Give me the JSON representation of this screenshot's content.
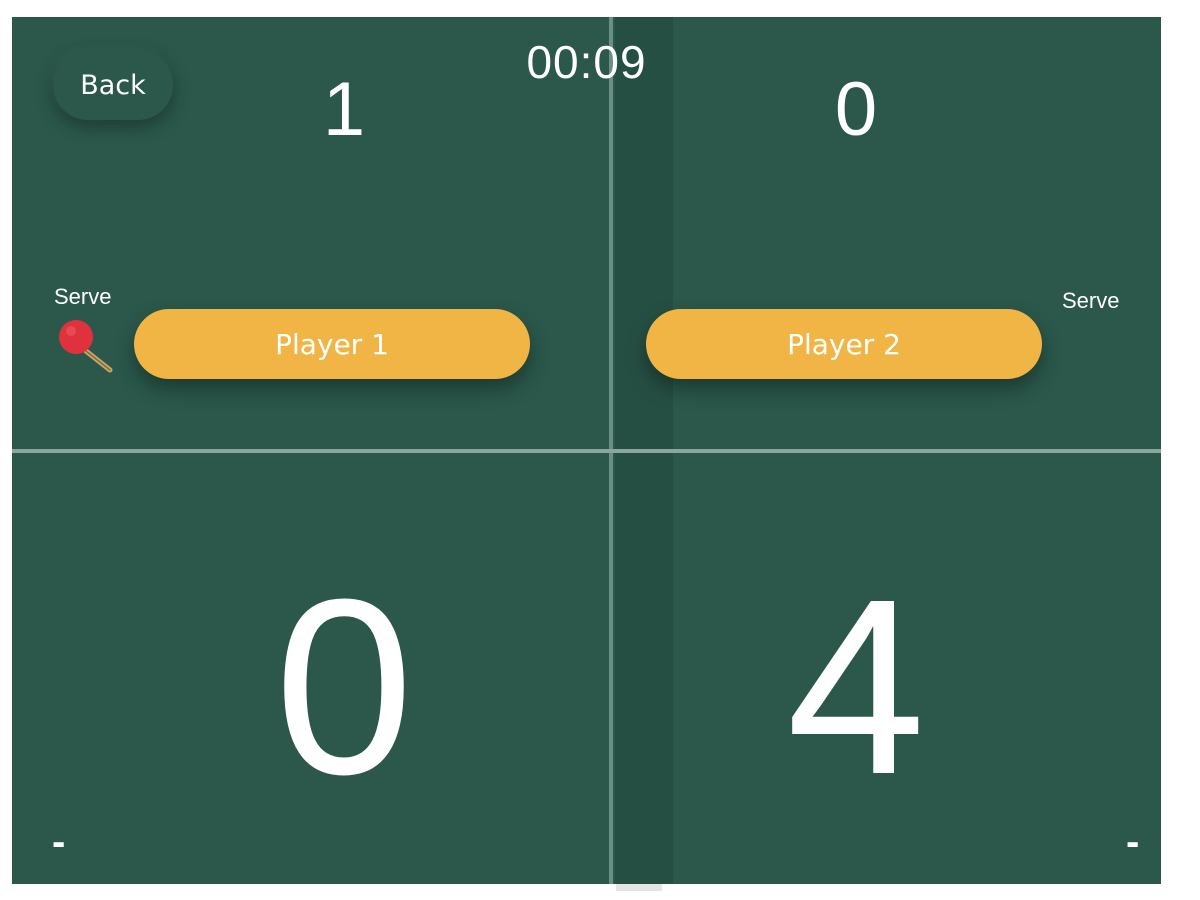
{
  "timer": "00:09",
  "back_label": "Back",
  "left": {
    "sets": "1",
    "points": "0",
    "player_name": "Player 1",
    "serve_label": "Serve",
    "minus_label": "-",
    "has_serve_icon": true
  },
  "right": {
    "sets": "0",
    "points": "4",
    "player_name": "Player 2",
    "serve_label": "Serve",
    "minus_label": "-"
  },
  "colors": {
    "table": "#2b584b",
    "net": "#264f43",
    "player_button": "#f0b545",
    "paddle": "#e0323c"
  },
  "icons": {
    "serve_indicator": "ping-pong-paddle-icon"
  }
}
